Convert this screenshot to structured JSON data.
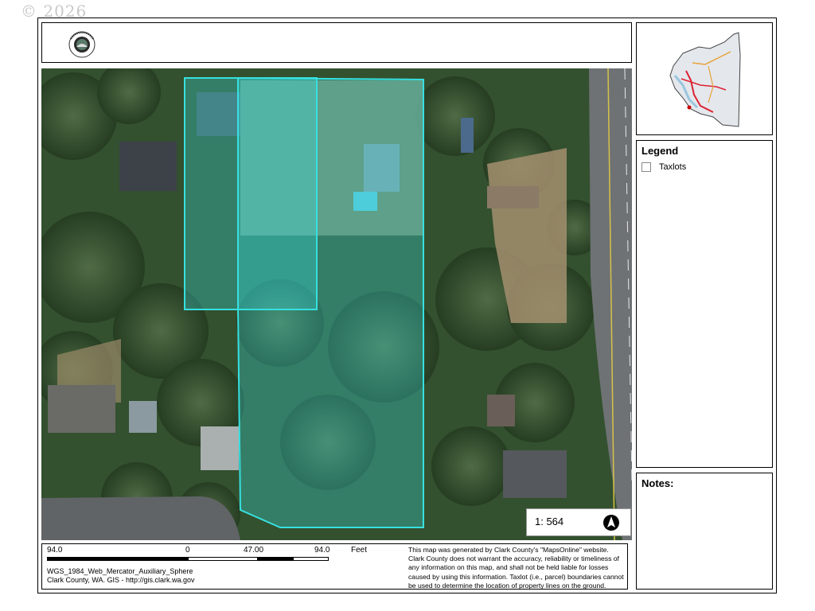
{
  "watermark": "© 2026",
  "map": {
    "taxlot_outline_color": "#37e0e0"
  },
  "scale": {
    "ratio_label": "1: 564",
    "tick_labels": [
      "94.0",
      "0",
      "47.00",
      "94.0"
    ],
    "unit": "Feet"
  },
  "legend": {
    "title": "Legend",
    "items": [
      {
        "label": "Taxlots",
        "icon": "empty-square-swatch"
      }
    ]
  },
  "notes": {
    "title": "Notes:"
  },
  "projection": {
    "line1": "WGS_1984_Web_Mercator_Auxiliary_Sphere",
    "line2": "Clark County, WA. GIS - http://gis.clark.wa.gov"
  },
  "disclaimer": {
    "line1": "This map was generated by Clark County's \"MapsOnline\" website.",
    "line2": "Clark County does not warrant the accuracy, reliability or timeliness of",
    "line3": "any information on this map, and shall not be held liable for losses",
    "line4": "caused by using this information. Taxlot (i.e., parcel) boundaries cannot",
    "line5": "be used to determine the location of property lines on the ground."
  },
  "icons": {
    "logo": "clark-county-seal",
    "north_arrow": "north-arrow-icon"
  }
}
